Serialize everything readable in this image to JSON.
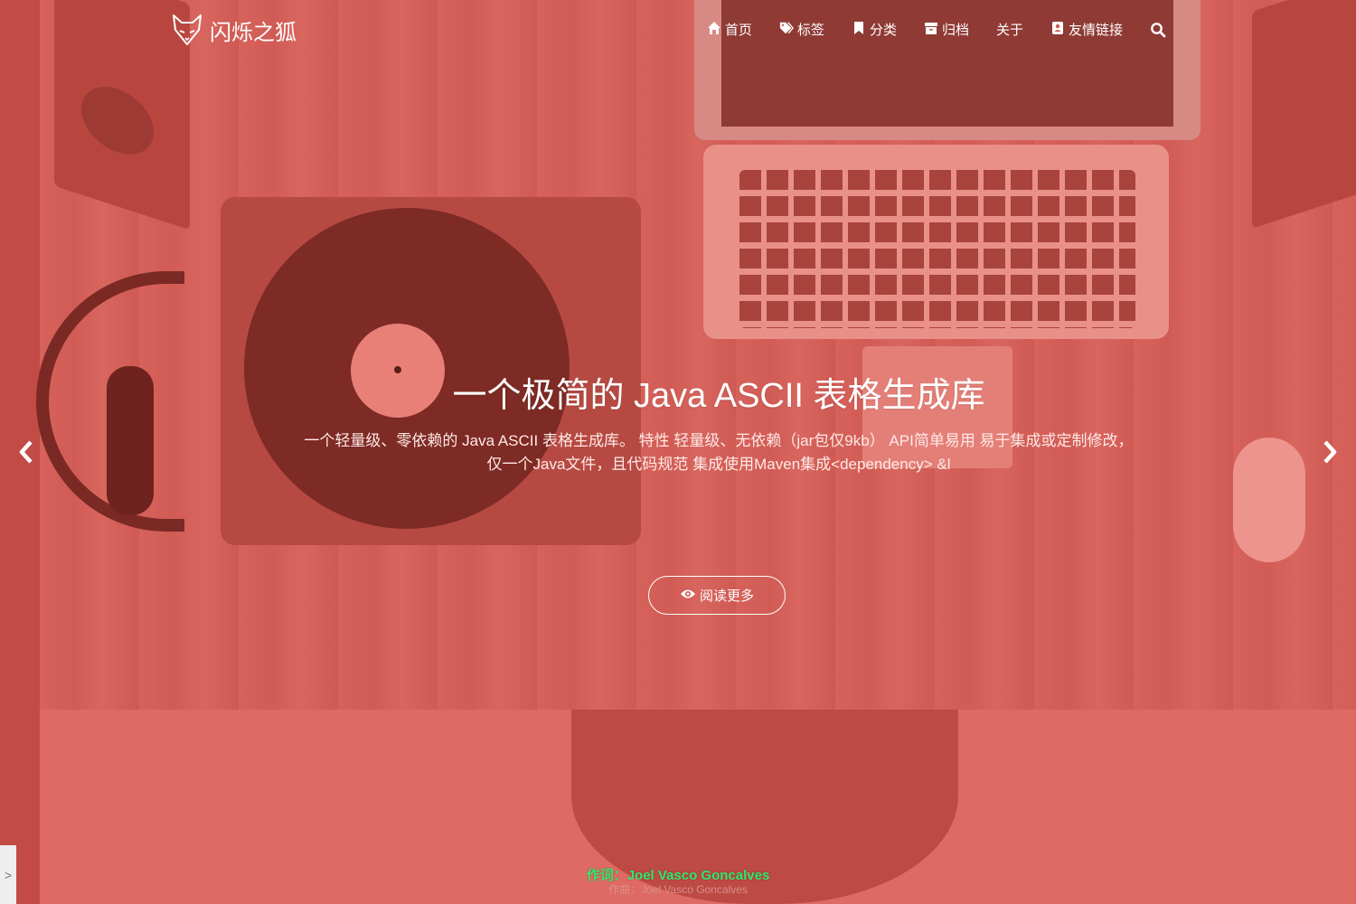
{
  "brand": {
    "name": "闪烁之狐",
    "logo_icon": "fox-icon"
  },
  "nav": {
    "items": [
      {
        "label": "首页",
        "icon": "home-icon"
      },
      {
        "label": "标签",
        "icon": "tags-icon"
      },
      {
        "label": "分类",
        "icon": "bookmark-icon"
      },
      {
        "label": "归档",
        "icon": "archive-icon"
      },
      {
        "label": "关于",
        "icon": ""
      },
      {
        "label": "友情链接",
        "icon": "address-card-icon"
      }
    ],
    "search_icon": "search-icon"
  },
  "hero": {
    "title": "一个极简的 Java ASCII 表格生成库",
    "description": "一个轻量级、零依赖的 Java ASCII 表格生成库。 特性 轻量级、无依赖（jar包仅9kb） API简单易用 易于集成或定制修改，仅一个Java文件，且代码规范 集成使用Maven集成<dependency> &l",
    "read_more_label": "阅读更多",
    "read_more_icon": "eye-icon"
  },
  "carousel": {
    "prev_icon": "chevron-left-icon",
    "next_icon": "chevron-right-icon"
  },
  "side_toggle": {
    "label": ">"
  },
  "lyrics": {
    "current": "作词：Joel Vasco Goncalves",
    "next": "作曲：Joel Vasco Goncalves"
  },
  "colors": {
    "overlay": "#c95a52",
    "lyric_current": "#2ee86c",
    "text": "#ffffff"
  }
}
